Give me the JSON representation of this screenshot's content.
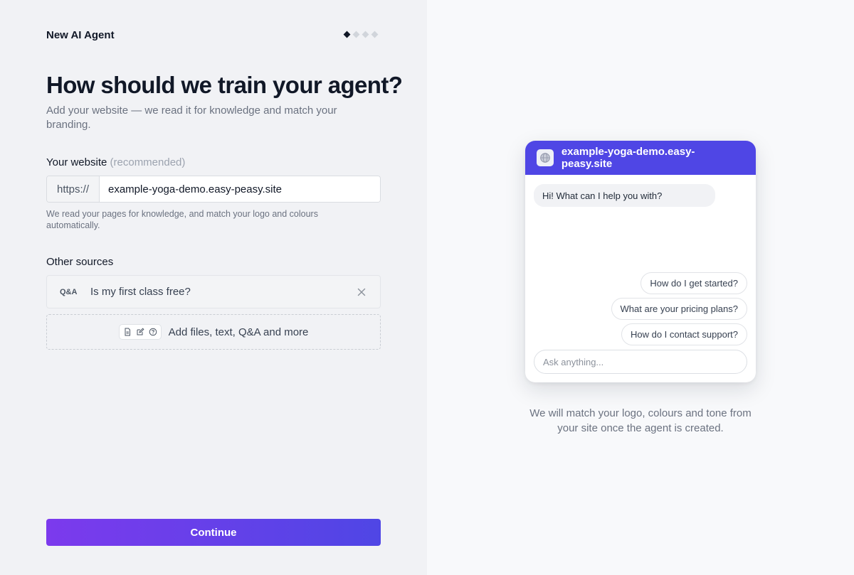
{
  "app": {
    "title": "New AI Agent",
    "steps_total": 4,
    "step_current": 1
  },
  "main": {
    "heading": "How should we train your agent?",
    "subtitle": "Add your website — we read it for knowledge and match your branding."
  },
  "website": {
    "label": "Your website",
    "label_hint": "(recommended)",
    "prefix": "https://",
    "value": "example-yoga-demo.easy-peasy.site",
    "help": "We read your pages for knowledge, and match your logo and colours automatically."
  },
  "sources": {
    "label": "Other sources",
    "items": [
      {
        "type": "Q&A",
        "text": "Is my first class free?"
      }
    ],
    "add_label": "Add files, text, Q&A and more",
    "add_icons": [
      "document-icon",
      "edit-icon",
      "help-circle-icon"
    ]
  },
  "actions": {
    "continue_label": "Continue"
  },
  "preview": {
    "header_title": "example-yoga-demo.easy-peasy.site",
    "header_icon": "globe-icon",
    "accent_color": "#4f46e5",
    "greeting": "Hi! What can I help you with?",
    "suggestions": [
      "How do I get started?",
      "What are your pricing plans?",
      "How do I contact support?"
    ],
    "input_placeholder": "Ask anything...",
    "note": "We will match your logo, colours and tone from your site once the agent is created."
  },
  "colors": {
    "button_gradient_start": "#7c3aed",
    "button_gradient_end": "#4f46e5"
  }
}
